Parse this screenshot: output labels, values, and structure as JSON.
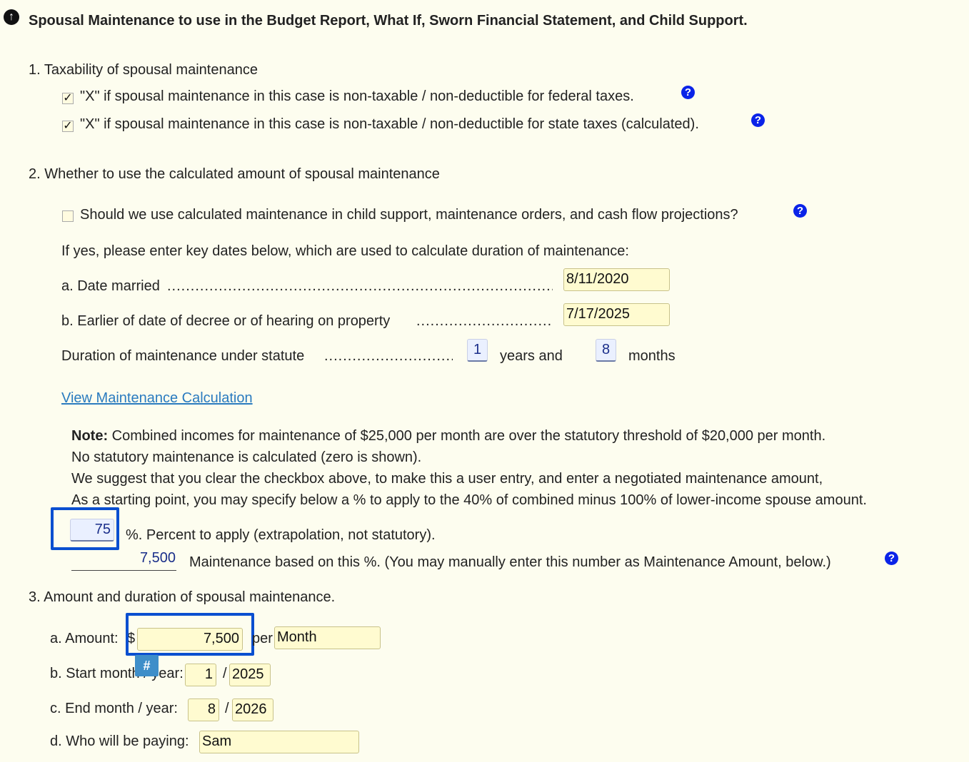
{
  "header": {
    "title": "Spousal Maintenance to use in the Budget Report, What If, Sworn Financial Statement, and Child Support."
  },
  "section1": {
    "heading": "1. Taxability of spousal maintenance",
    "federal_label": "\"X\" if spousal maintenance in this case is non-taxable / non-deductible for federal taxes.",
    "federal_checked": true,
    "state_label": "\"X\" if spousal maintenance in this case is non-taxable / non-deductible for state taxes (calculated).",
    "state_checked": true
  },
  "section2": {
    "heading": "2. Whether to use the calculated amount of spousal maintenance",
    "use_calc_label": "Should we use calculated maintenance in child support, maintenance orders, and cash flow projections?",
    "use_calc_checked": false,
    "intro": "If yes, please enter key dates below, which are used to calculate duration of maintenance:",
    "date_married_label": "a. Date married",
    "date_married": "8/11/2020",
    "decree_label": "b. Earlier of date of decree or of hearing on property",
    "decree_date": "7/17/2025",
    "duration_label": "Duration of maintenance under statute",
    "duration_years": "1",
    "years_and": "years and",
    "duration_months": "8",
    "months": "months",
    "view_link": "View Maintenance Calculation",
    "note_bold": "Note:",
    "note_line1": " Combined incomes for maintenance of $25,000 per month are over the statutory threshold of $20,000 per month.",
    "note_line2": "No statutory maintenance is calculated (zero is shown).",
    "note_line3": "We suggest that you clear the checkbox above, to make this a user entry, and enter a negotiated maintenance amount,",
    "note_line4": "As a starting point, you may specify below a % to apply to the 40% of combined minus 100% of lower-income spouse amount.",
    "percent_value": "75",
    "percent_label": "%. Percent to apply (extrapolation, not statutory).",
    "based_value": "7,500",
    "based_label": "Maintenance based on this %. (You may manually enter this number as Maintenance Amount, below.)"
  },
  "section3": {
    "heading": "3. Amount and duration of spousal maintenance.",
    "amount_label": "a. Amount:",
    "dollar": "$",
    "amount_value": "7,500",
    "per": "per",
    "period": "Month",
    "start_label": "b. Start month / year:",
    "start_month": "1",
    "start_year": "2025",
    "slash": "/",
    "end_label": "c. End month / year:",
    "end_month": "8",
    "end_year": "2026",
    "payer_label": "d. Who will be paying:",
    "payer": "Sam",
    "hash_label": "#"
  },
  "icons": {
    "up": "circle-up-arrow-icon",
    "help": "question-circle-icon",
    "check": "checkmark-icon"
  },
  "colors": {
    "background": "#fdfdef",
    "field_yellow": "#fffbd0",
    "field_blue": "#eaf0ff",
    "highlight": "#0a4fd0",
    "help_blue": "#0a23e8",
    "link": "#2a7bbf"
  }
}
